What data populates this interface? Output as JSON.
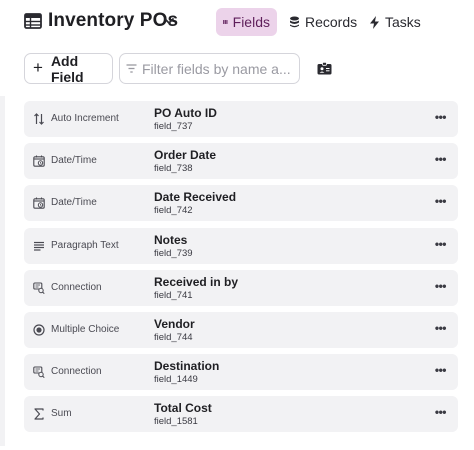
{
  "header": {
    "title": "Inventory POs",
    "tabs": [
      {
        "label": "Fields",
        "icon": "columns-icon",
        "active": true
      },
      {
        "label": "Records",
        "icon": "database-icon",
        "active": false
      },
      {
        "label": "Tasks",
        "icon": "bolt-icon",
        "active": false
      }
    ]
  },
  "toolbar": {
    "add_label": "Add Field",
    "filter_placeholder": "Filter fields by name a..."
  },
  "fields": [
    {
      "type": "Auto Increment",
      "type_icon": "sort-arrows-icon",
      "name": "PO Auto ID",
      "id": "field_737"
    },
    {
      "type": "Date/Time",
      "type_icon": "calendar-clock-icon",
      "name": "Order Date",
      "id": "field_738"
    },
    {
      "type": "Date/Time",
      "type_icon": "calendar-clock-icon",
      "name": "Date Received",
      "id": "field_742"
    },
    {
      "type": "Paragraph Text",
      "type_icon": "paragraph-icon",
      "name": "Notes",
      "id": "field_739"
    },
    {
      "type": "Connection",
      "type_icon": "connection-icon",
      "name": "Received in by",
      "id": "field_741"
    },
    {
      "type": "Multiple Choice",
      "type_icon": "radio-icon",
      "name": "Vendor",
      "id": "field_744"
    },
    {
      "type": "Connection",
      "type_icon": "connection-icon",
      "name": "Destination",
      "id": "field_1449"
    },
    {
      "type": "Sum",
      "type_icon": "sigma-icon",
      "name": "Total Cost",
      "id": "field_1581"
    }
  ],
  "colors": {
    "active_tab_bg": "#ecd3ea",
    "active_tab_fg": "#5e1e5a",
    "row_bg": "#f2f2f4"
  }
}
